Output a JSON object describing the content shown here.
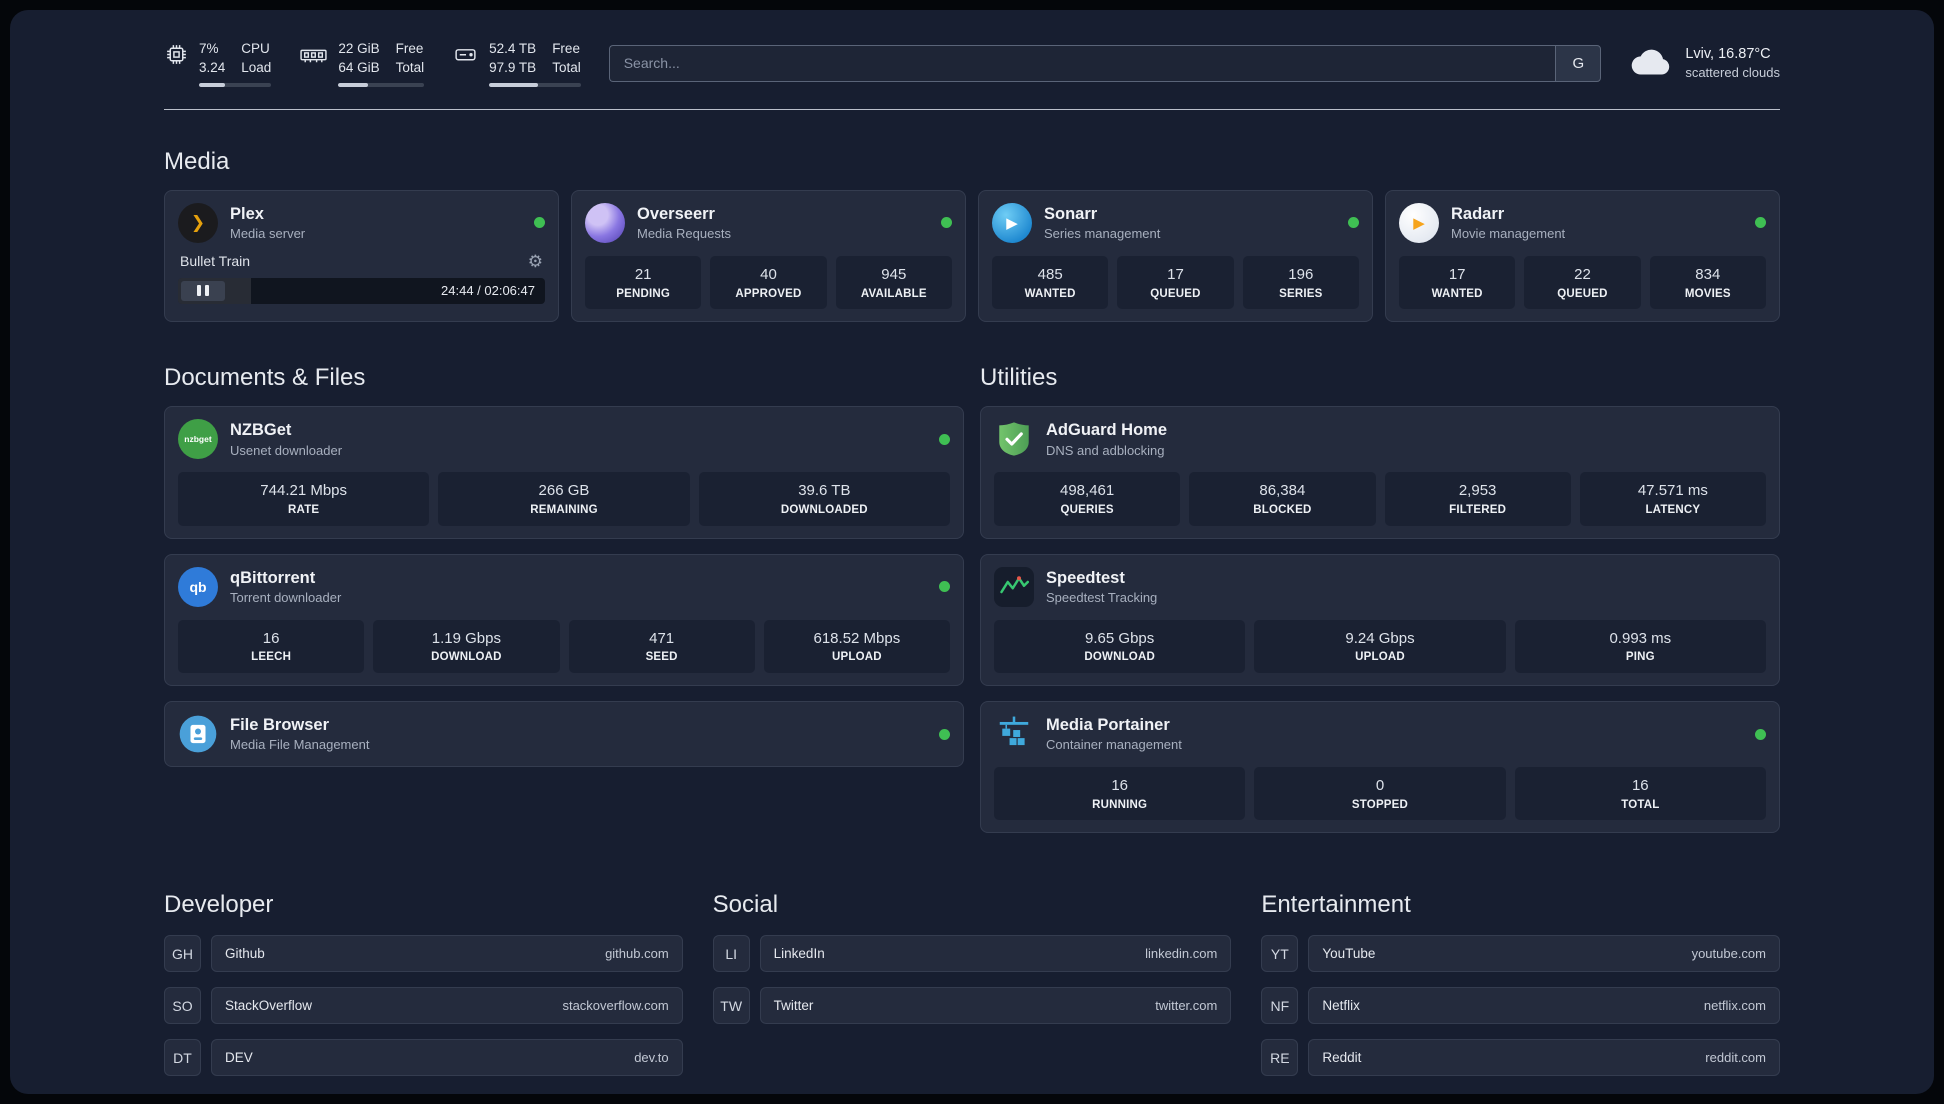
{
  "colors": {
    "accent_green": "#3fbf53",
    "page_bg": "#171e30",
    "card_bg": "#242b3d"
  },
  "icons": {
    "gear": "⚙",
    "plex_glyph": "❯",
    "play_glyph": "▶",
    "qbittorrent_glyph": "qb",
    "nzbget_glyph": "nzbget"
  },
  "topbar": {
    "cpu": {
      "value_top": "7%",
      "value_bottom": "3.24",
      "label_top": "CPU",
      "label_bottom": "Load",
      "bar_percent": 36
    },
    "ram": {
      "value_top": "22 GiB",
      "value_bottom": "64 GiB",
      "label_top": "Free",
      "label_bottom": "Total",
      "bar_percent": 34
    },
    "disk": {
      "value_top": "52.4 TB",
      "value_bottom": "97.9 TB",
      "label_top": "Free",
      "label_bottom": "Total",
      "bar_percent": 53
    },
    "search": {
      "placeholder": "Search...",
      "engine_label": "G"
    },
    "weather": {
      "location": "Lviv, 16.87°C",
      "condition": "scattered clouds"
    }
  },
  "sections": {
    "media": {
      "title": "Media",
      "apps": [
        {
          "name": "Plex",
          "subtitle": "Media server",
          "player": {
            "now_playing": "Bullet Train",
            "time": "24:44 / 02:06:47",
            "progress_percent": 20
          }
        },
        {
          "name": "Overseerr",
          "subtitle": "Media Requests",
          "stats": [
            {
              "value": "21",
              "label": "PENDING"
            },
            {
              "value": "40",
              "label": "APPROVED"
            },
            {
              "value": "945",
              "label": "AVAILABLE"
            }
          ]
        },
        {
          "name": "Sonarr",
          "subtitle": "Series management",
          "stats": [
            {
              "value": "485",
              "label": "WANTED"
            },
            {
              "value": "17",
              "label": "QUEUED"
            },
            {
              "value": "196",
              "label": "SERIES"
            }
          ]
        },
        {
          "name": "Radarr",
          "subtitle": "Movie management",
          "stats": [
            {
              "value": "17",
              "label": "WANTED"
            },
            {
              "value": "22",
              "label": "QUEUED"
            },
            {
              "value": "834",
              "label": "MOVIES"
            }
          ]
        }
      ]
    },
    "documents": {
      "title": "Documents & Files",
      "apps": [
        {
          "name": "NZBGet",
          "subtitle": "Usenet downloader",
          "stats": [
            {
              "value": "744.21 Mbps",
              "label": "RATE"
            },
            {
              "value": "266 GB",
              "label": "REMAINING"
            },
            {
              "value": "39.6 TB",
              "label": "DOWNLOADED"
            }
          ]
        },
        {
          "name": "qBittorrent",
          "subtitle": "Torrent downloader",
          "stats": [
            {
              "value": "16",
              "label": "LEECH"
            },
            {
              "value": "1.19 Gbps",
              "label": "DOWNLOAD"
            },
            {
              "value": "471",
              "label": "SEED"
            },
            {
              "value": "618.52 Mbps",
              "label": "UPLOAD"
            }
          ]
        },
        {
          "name": "File Browser",
          "subtitle": "Media File Management"
        }
      ]
    },
    "utilities": {
      "title": "Utilities",
      "apps": [
        {
          "name": "AdGuard Home",
          "subtitle": "DNS and adblocking",
          "stats": [
            {
              "value": "498,461",
              "label": "QUERIES"
            },
            {
              "value": "86,384",
              "label": "BLOCKED"
            },
            {
              "value": "2,953",
              "label": "FILTERED"
            },
            {
              "value": "47.571 ms",
              "label": "LATENCY"
            }
          ]
        },
        {
          "name": "Speedtest",
          "subtitle": "Speedtest Tracking",
          "stats": [
            {
              "value": "9.65 Gbps",
              "label": "DOWNLOAD"
            },
            {
              "value": "9.24 Gbps",
              "label": "UPLOAD"
            },
            {
              "value": "0.993 ms",
              "label": "PING"
            }
          ]
        },
        {
          "name": "Media Portainer",
          "subtitle": "Container management",
          "stats": [
            {
              "value": "16",
              "label": "RUNNING"
            },
            {
              "value": "0",
              "label": "STOPPED"
            },
            {
              "value": "16",
              "label": "TOTAL"
            }
          ]
        }
      ]
    }
  },
  "bookmarks": [
    {
      "title": "Developer",
      "items": [
        {
          "abbr": "GH",
          "name": "Github",
          "url": "github.com"
        },
        {
          "abbr": "SO",
          "name": "StackOverflow",
          "url": "stackoverflow.com"
        },
        {
          "abbr": "DT",
          "name": "DEV",
          "url": "dev.to"
        }
      ]
    },
    {
      "title": "Social",
      "items": [
        {
          "abbr": "LI",
          "name": "LinkedIn",
          "url": "linkedin.com"
        },
        {
          "abbr": "TW",
          "name": "Twitter",
          "url": "twitter.com"
        }
      ]
    },
    {
      "title": "Entertainment",
      "items": [
        {
          "abbr": "YT",
          "name": "YouTube",
          "url": "youtube.com"
        },
        {
          "abbr": "NF",
          "name": "Netflix",
          "url": "netflix.com"
        },
        {
          "abbr": "RE",
          "name": "Reddit",
          "url": "reddit.com"
        }
      ]
    }
  ]
}
